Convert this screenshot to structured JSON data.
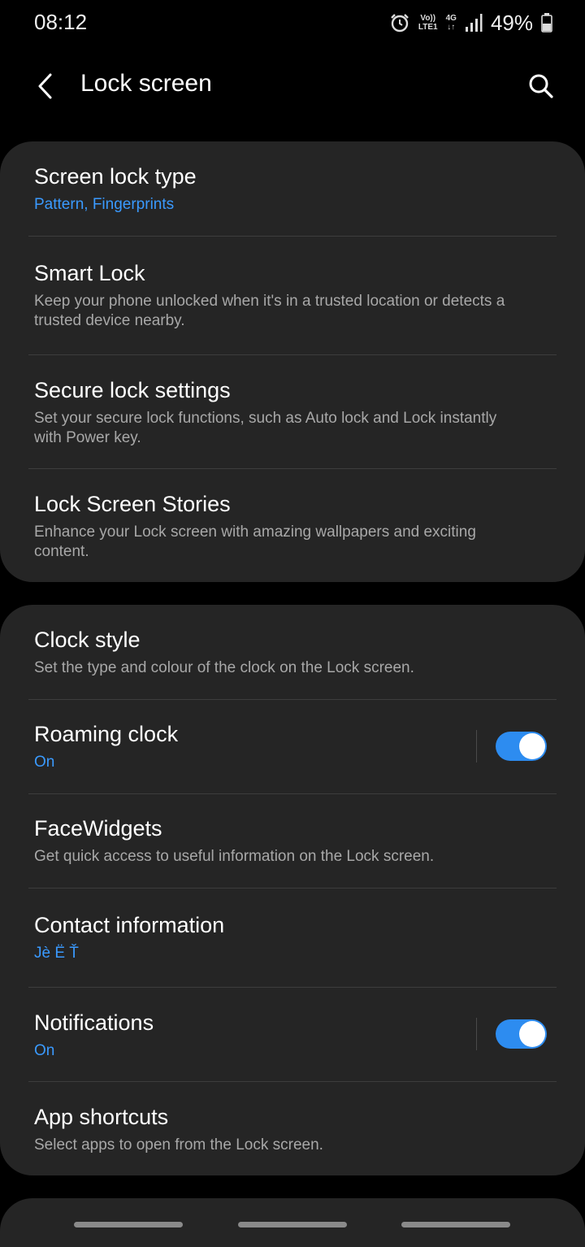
{
  "status": {
    "time": "08:12",
    "volte_top": "Vo))",
    "volte_bottom": "LTE1",
    "net_top": "4G",
    "battery": "49%",
    "icons": [
      "alarm-icon",
      "volte-icon",
      "4g-icon",
      "signal-icon",
      "battery-icon"
    ]
  },
  "header": {
    "title": "Lock screen",
    "back_icon": "back-arrow-icon",
    "search_icon": "search-icon"
  },
  "section1": [
    {
      "title": "Screen lock type",
      "subtitle": "Pattern, Fingerprints"
    },
    {
      "title": "Smart Lock",
      "subtitle_line1": "Keep your phone unlocked when it's in a trusted location or detects a",
      "subtitle_line2": "trusted device nearby."
    },
    {
      "title": "Secure lock settings",
      "subtitle_line1": "Set your secure lock functions, such as Auto lock and Lock instantly",
      "subtitle_line2": "with Power key."
    },
    {
      "title": "Lock Screen Stories",
      "subtitle_line1": "Enhance your Lock screen with amazing wallpapers and exciting",
      "subtitle_line2": "content."
    }
  ],
  "section2": [
    {
      "title": "Clock style",
      "subtitle": "Set the type and colour of the clock on the Lock screen."
    },
    {
      "title": "Roaming clock",
      "subtitle": "On",
      "toggle": true
    },
    {
      "title": "FaceWidgets",
      "subtitle": "Get quick access to useful information on the Lock screen."
    },
    {
      "title": "Contact information",
      "subtitle": "Jè Ë Ť"
    },
    {
      "title": "Notifications",
      "subtitle": "On",
      "toggle": true
    },
    {
      "title": "App shortcuts",
      "subtitle": "Select apps to open from the Lock screen."
    }
  ],
  "colors": {
    "background": "#000000",
    "card": "#252525",
    "accent_blue": "#3a9aff",
    "toggle_on": "#2d8cf0",
    "secondary_text": "#a8a8a8"
  }
}
